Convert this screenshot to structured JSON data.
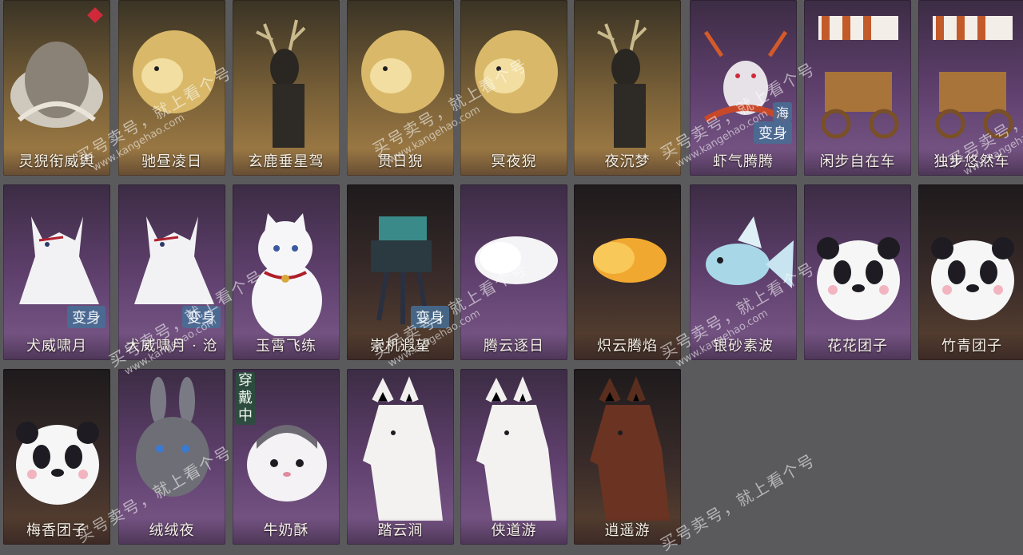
{
  "rows": [
    [
      {
        "name": "灵猊衔威舆",
        "style": "gold",
        "icon": "chariot-icon",
        "heart": true
      },
      {
        "name": "驰昼凌日",
        "style": "gold",
        "icon": "lion-icon"
      },
      {
        "name": "玄鹿垂星驾",
        "style": "gold",
        "icon": "deer-icon"
      },
      {
        "name": "贯日猊",
        "style": "gold",
        "icon": "lion-icon"
      },
      {
        "name": "冥夜猊",
        "style": "gold",
        "icon": "lion-icon"
      },
      {
        "name": "夜沉梦",
        "style": "gold",
        "icon": "deer-icon"
      },
      {
        "name": "虾气腾腾",
        "style": "purple",
        "icon": "shrimp-icon",
        "badge": "变身",
        "badge2": "海"
      },
      {
        "name": "闲步自在车",
        "style": "purple",
        "icon": "cart-icon"
      },
      {
        "name": "独步悠然车",
        "style": "purple",
        "icon": "cart-icon"
      }
    ],
    [
      {
        "name": "犬威啸月",
        "style": "purple",
        "icon": "wolf-icon",
        "badge": "变身"
      },
      {
        "name": "犬威啸月 · 沧",
        "style": "purple",
        "icon": "wolf-icon",
        "badge": "变身"
      },
      {
        "name": "玉霄飞练",
        "style": "purple",
        "icon": "cat-icon"
      },
      {
        "name": "崇机遐望",
        "style": "dark",
        "icon": "machine-icon",
        "badge": "变身"
      },
      {
        "name": "腾云逐日",
        "style": "purple",
        "icon": "cloud-icon"
      },
      {
        "name": "炽云腾焰",
        "style": "dark",
        "icon": "cloud-icon"
      },
      {
        "name": "银砂素波",
        "style": "purple",
        "icon": "fish-icon"
      },
      {
        "name": "花花团子",
        "style": "purple",
        "icon": "panda-icon"
      },
      {
        "name": "竹青团子",
        "style": "dark",
        "icon": "panda-icon"
      }
    ],
    [
      {
        "name": "梅香团子",
        "style": "dark",
        "icon": "panda-icon"
      },
      {
        "name": "绒绒夜",
        "style": "purple",
        "icon": "rabbit-icon"
      },
      {
        "name": "牛奶酥",
        "style": "purple",
        "icon": "hamster-icon",
        "vbadge": "穿戴中"
      },
      {
        "name": "踏云涧",
        "style": "purple",
        "icon": "horse-icon"
      },
      {
        "name": "侠道游",
        "style": "purple",
        "icon": "horse-icon"
      },
      {
        "name": "逍遥游",
        "style": "dark",
        "icon": "horse-icon"
      }
    ]
  ],
  "watermark": {
    "text": "买号卖号，就上看个号",
    "url": "www.kangehao.com"
  },
  "colors": {
    "card_purple": "#5e3f6c",
    "card_gold": "#7a6138",
    "badge_bg": "#466e96",
    "background": "#5a5a5c"
  }
}
